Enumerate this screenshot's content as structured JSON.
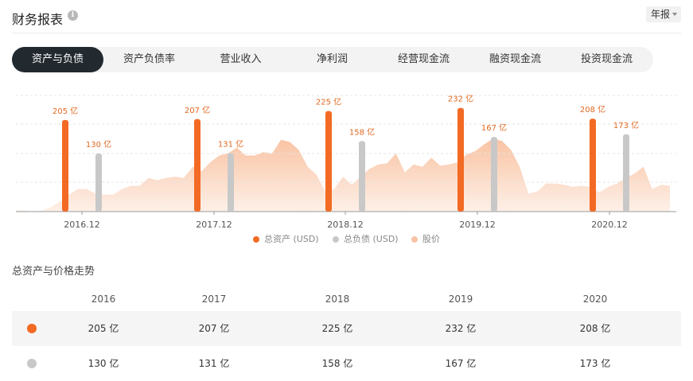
{
  "header": {
    "title": "财务报表",
    "info_icon": "info-icon",
    "period_label": "年报"
  },
  "tabs": [
    {
      "label": "资产与负债",
      "active": true
    },
    {
      "label": "资产负债率",
      "active": false
    },
    {
      "label": "营业收入",
      "active": false
    },
    {
      "label": "净利润",
      "active": false
    },
    {
      "label": "经营现金流",
      "active": false
    },
    {
      "label": "融资现金流",
      "active": false
    },
    {
      "label": "投资现金流",
      "active": false
    }
  ],
  "colors": {
    "assets": "#f36a24",
    "liabilities": "#c8c8c8",
    "price": "#f9c3a3",
    "label_text": "#e2681f",
    "active_tab": "#22292f"
  },
  "chart_data": {
    "type": "bar",
    "categories": [
      "2016.12",
      "2017.12",
      "2018.12",
      "2019.12",
      "2020.12"
    ],
    "series": [
      {
        "name": "总资产 (USD)",
        "values": [
          205,
          207,
          225,
          232,
          208
        ],
        "labels": [
          "205 亿",
          "207 亿",
          "225 亿",
          "232 亿",
          "208 亿"
        ]
      },
      {
        "name": "总负债 (USD)",
        "values": [
          130,
          131,
          158,
          167,
          173
        ],
        "labels": [
          "130 亿",
          "131 亿",
          "158 亿",
          "167 亿",
          "173 亿"
        ]
      }
    ],
    "price_series": {
      "name": "股价",
      "type": "area",
      "values": [
        1,
        1,
        0,
        1,
        4,
        9,
        15,
        20,
        20,
        16,
        15,
        15,
        20,
        23,
        23,
        30,
        28,
        30,
        31,
        30,
        40,
        36,
        44,
        50,
        52,
        57,
        50,
        50,
        53,
        52,
        64,
        62,
        55,
        40,
        33,
        18,
        20,
        31,
        24,
        31,
        38,
        42,
        43,
        52,
        35,
        42,
        40,
        48,
        41,
        42,
        44,
        51,
        54,
        60,
        65,
        63,
        55,
        40,
        16,
        18,
        25,
        25,
        24,
        22,
        23,
        22,
        17,
        22,
        25,
        30,
        34,
        40,
        20,
        24,
        23
      ]
    },
    "ylim": [
      0,
      260
    ],
    "grid": true,
    "legend_position": "bottom"
  },
  "legend": [
    {
      "label": "总资产 (USD)",
      "color": "#f36a24"
    },
    {
      "label": "总负债 (USD)",
      "color": "#c8c8c8"
    },
    {
      "label": "股价",
      "color": "#f9c3a3"
    }
  ],
  "table": {
    "subtitle": "总资产与价格走势",
    "years": [
      "2016",
      "2017",
      "2018",
      "2019",
      "2020"
    ],
    "rows": [
      {
        "color": "#f36a24",
        "values": [
          "205 亿",
          "207 亿",
          "225 亿",
          "232 亿",
          "208 亿"
        ]
      },
      {
        "color": "#c8c8c8",
        "values": [
          "130 亿",
          "131 亿",
          "158 亿",
          "167 亿",
          "173 亿"
        ]
      }
    ]
  }
}
